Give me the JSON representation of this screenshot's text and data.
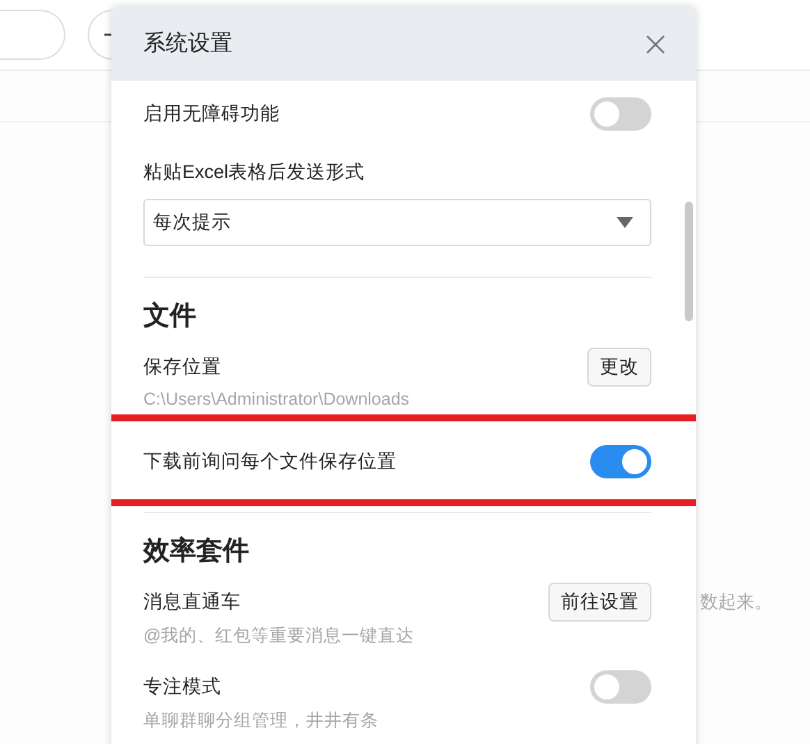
{
  "background": {
    "hint_text": "数起来。"
  },
  "dialog": {
    "title": "系统设置",
    "sections": [
      {
        "items": [
          {
            "kind": "toggle",
            "label": "启用无障碍功能",
            "on": false
          },
          {
            "kind": "select",
            "label": "粘贴Excel表格后发送形式",
            "value": "每次提示"
          }
        ]
      },
      {
        "heading": "文件",
        "items": [
          {
            "kind": "button",
            "label": "保存位置",
            "button": "更改",
            "description": "C:\\Users\\Administrator\\Downloads"
          },
          {
            "kind": "toggle",
            "label": "下载前询问每个文件保存位置",
            "on": true,
            "highlighted": true
          }
        ]
      },
      {
        "heading": "效率套件",
        "items": [
          {
            "kind": "button",
            "label": "消息直通车",
            "button": "前往设置",
            "description": "@我的、红包等重要消息一键直达"
          },
          {
            "kind": "toggle",
            "label": "专注模式",
            "on": false,
            "description": "单聊群聊分组管理，井井有条"
          }
        ]
      }
    ]
  }
}
